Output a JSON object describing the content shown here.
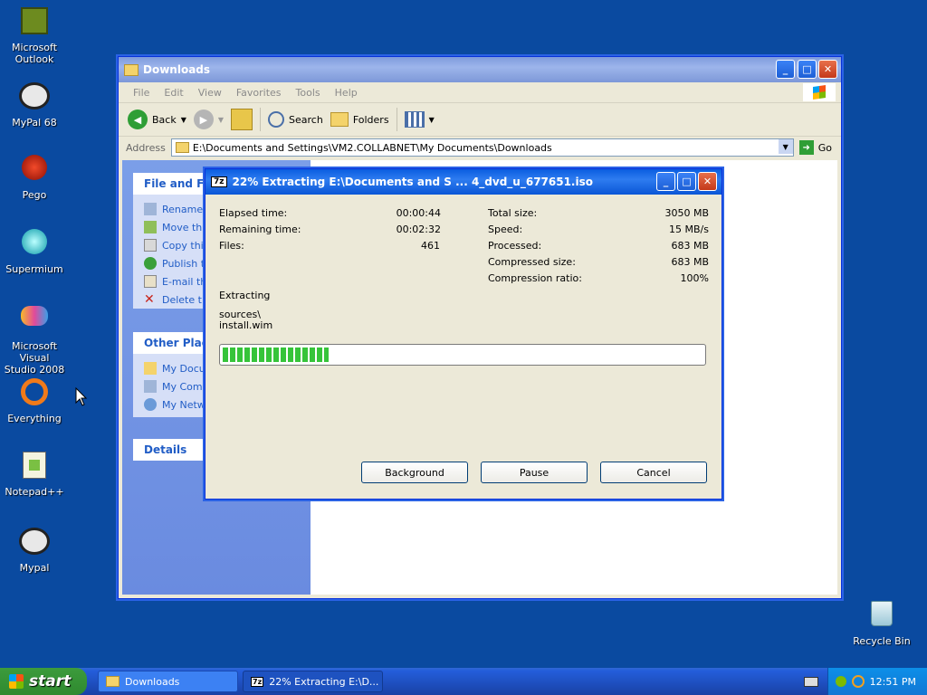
{
  "desktop": {
    "icons": [
      {
        "label_line1": "Microsoft",
        "label_line2": "Outlook"
      },
      {
        "label_line1": "MyPal 68",
        "label_line2": ""
      },
      {
        "label_line1": "Pego",
        "label_line2": ""
      },
      {
        "label_line1": "Supermium",
        "label_line2": ""
      },
      {
        "label_line1": "Microsoft Visual",
        "label_line2": "Studio 2008"
      },
      {
        "label_line1": "Everything",
        "label_line2": ""
      },
      {
        "label_line1": "Notepad++",
        "label_line2": ""
      },
      {
        "label_line1": "Mypal",
        "label_line2": ""
      },
      {
        "label_line1": "Recycle Bin",
        "label_line2": ""
      }
    ]
  },
  "explorer": {
    "title": "Downloads",
    "menu": [
      "File",
      "Edit",
      "View",
      "Favorites",
      "Tools",
      "Help"
    ],
    "toolbar": {
      "back": "Back",
      "search": "Search",
      "folders": "Folders"
    },
    "address_label": "Address",
    "address_value": "E:\\Documents and Settings\\VM2.COLLABNET\\My Documents\\Downloads",
    "go": "Go",
    "taskpane": {
      "file_tasks_title": "File and Folde",
      "file_tasks": [
        "Rename t",
        "Move this",
        "Copy this",
        "Publish th",
        "E-mail thi",
        "Delete th"
      ],
      "other_places_title": "Other Places",
      "other_places": [
        "My Docum",
        "My Comp",
        "My Netwo"
      ],
      "details_title": "Details"
    }
  },
  "dialog": {
    "title": "22% Extracting E:\\Documents and S ... 4_dvd_u_677651.iso",
    "left_labels": [
      "Elapsed time:",
      "Remaining time:",
      "Files:"
    ],
    "left_values": [
      "00:00:44",
      "00:02:32",
      "461"
    ],
    "right_labels": [
      "Total size:",
      "Speed:",
      "Processed:",
      "Compressed size:",
      "Compression ratio:"
    ],
    "right_values": [
      "3050 MB",
      "15 MB/s",
      "683 MB",
      "683 MB",
      "100%"
    ],
    "status": "Extracting",
    "path_line1": "sources\\",
    "path_line2": "install.wim",
    "progress": 0.22,
    "buttons": {
      "background": "Background",
      "pause": "Pause",
      "cancel": "Cancel"
    }
  },
  "taskbar": {
    "start": "start",
    "tasks": [
      "Downloads",
      "22% Extracting E:\\D..."
    ],
    "clock": "12:51 PM"
  },
  "colors": {
    "accent": "#0a5de0",
    "progress": "#36c43a",
    "desktop": "#0a4aa0"
  }
}
